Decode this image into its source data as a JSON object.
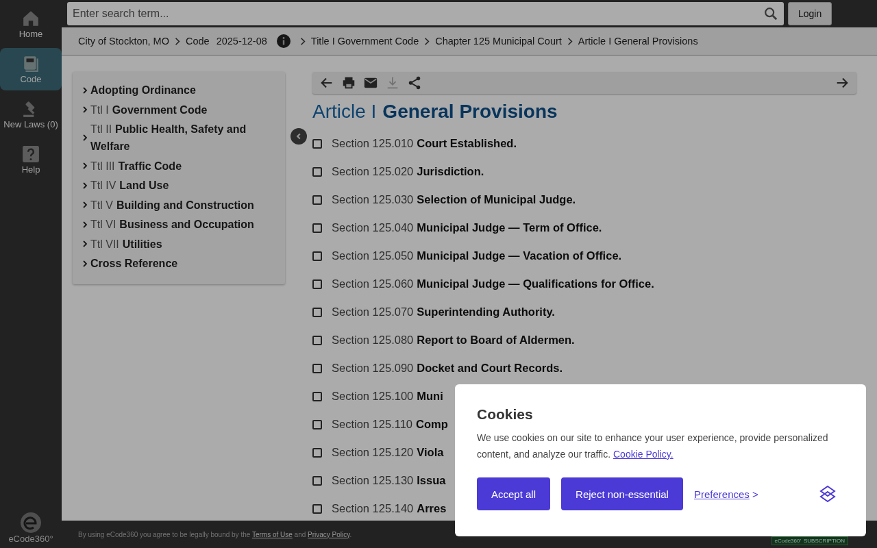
{
  "rail": [
    {
      "kind": "home",
      "label": "Home",
      "selected": false
    },
    {
      "kind": "code",
      "label": "Code",
      "selected": true
    },
    {
      "kind": "laws",
      "label": "New Laws (0)",
      "selected": false
    },
    {
      "kind": "help",
      "label": "Help",
      "selected": false
    }
  ],
  "logo": "eCode360°",
  "search": {
    "placeholder": "Enter search term..."
  },
  "login": "Login",
  "breadcrumb": {
    "items": [
      "City of Stockton, MO",
      "Code"
    ],
    "date": "2025-12-08",
    "trail": [
      "Title I Government Code",
      "Chapter 125 Municipal Court",
      "Article I General Provisions"
    ]
  },
  "toc": [
    {
      "title": "Adopting Ordinance"
    },
    {
      "prefix": "Ttl I",
      "title": "Government Code"
    },
    {
      "prefix": "Ttl II",
      "title": "Public Health, Safety and Welfare"
    },
    {
      "prefix": "Ttl III",
      "title": "Traffic Code"
    },
    {
      "prefix": "Ttl IV",
      "title": "Land Use"
    },
    {
      "prefix": "Ttl V",
      "title": "Building and Construction"
    },
    {
      "prefix": "Ttl VI",
      "title": "Business and Occupation"
    },
    {
      "prefix": "Ttl VII",
      "title": "Utilities"
    },
    {
      "title": "Cross Reference"
    }
  ],
  "heading": {
    "prefix": "Article I",
    "title": "General Provisions"
  },
  "sections": [
    {
      "number": "Section 125.010",
      "title": "Court Established.",
      "checked": false
    },
    {
      "number": "Section 125.020",
      "title": "Jurisdiction.",
      "checked": false
    },
    {
      "number": "Section 125.030",
      "title": "Selection of Municipal Judge.",
      "checked": false
    },
    {
      "number": "Section 125.040",
      "title": "Municipal Judge — Term of Office.",
      "checked": false
    },
    {
      "number": "Section 125.050",
      "title": "Municipal Judge — Vacation of Office.",
      "checked": false
    },
    {
      "number": "Section 125.060",
      "title": "Municipal Judge — Qualifications for Office.",
      "checked": false
    },
    {
      "number": "Section 125.070",
      "title": "Superintending Authority.",
      "checked": false
    },
    {
      "number": "Section 125.080",
      "title": "Report to Board of Aldermen.",
      "checked": false
    },
    {
      "number": "Section 125.090",
      "title": "Docket and Court Records.",
      "checked": false
    },
    {
      "number": "Section 125.100",
      "title": "Muni",
      "checked": false
    },
    {
      "number": "Section 125.110",
      "title": "Comp",
      "checked": false
    },
    {
      "number": "Section 125.120",
      "title": "Viola",
      "checked": false
    },
    {
      "number": "Section 125.130",
      "title": "Issua",
      "checked": false
    },
    {
      "number": "Section 125.140",
      "title": "Arres",
      "checked": false
    }
  ],
  "footer": {
    "before": "By using eCode360 you agree to be legally bound by the",
    "terms": "Terms of Use",
    "and": "and",
    "privacy": "Privacy Policy",
    "after": ".",
    "badge": [
      "eCode360'",
      "SUBSCRIPTION"
    ]
  },
  "cookies": {
    "title": "Cookies",
    "text": "We use cookies on our site to enhance your user experience, provide personalized content, and analyze our traffic.",
    "policy": "Cookie Policy.",
    "accept": "Accept all",
    "reject": "Reject non-essential",
    "preferences": "Preferences",
    "preferences_arrow": ">"
  }
}
